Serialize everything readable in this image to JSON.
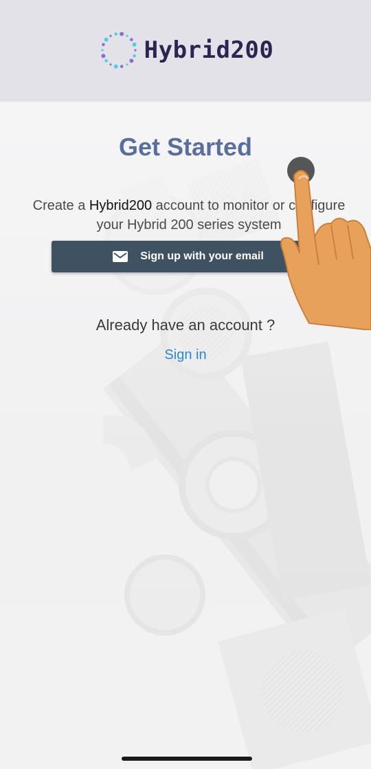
{
  "header": {
    "logo_text": "Hybrid200",
    "logo_icon": "dotted-ring-logo-icon"
  },
  "main": {
    "title": "Get Started",
    "description_prefix": "Create a ",
    "description_brand": "Hybrid200",
    "description_suffix": " account to monitor or configure your Hybrid 200 series system",
    "signup_button_label": "Sign up with your email",
    "signup_button_icon": "mail-icon",
    "already_text": "Already have an account ?",
    "signin_link": "Sign in"
  },
  "colors": {
    "header_bg": "#e4e2e9",
    "title": "#5a6e9c",
    "button_bg": "#3f5261",
    "link": "#2f86c8",
    "pointer_hand": "#e8a15a"
  }
}
